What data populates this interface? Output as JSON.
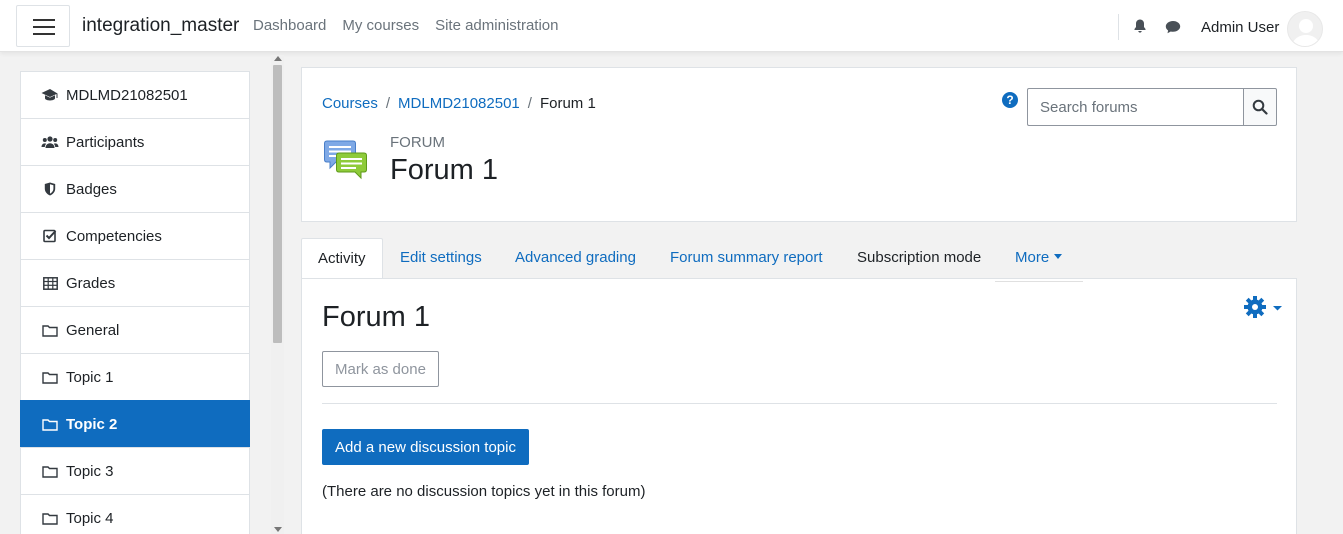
{
  "navbar": {
    "brand": "integration_master",
    "links": [
      "Dashboard",
      "My courses",
      "Site administration"
    ],
    "user_name": "Admin User"
  },
  "drawer": {
    "items": [
      {
        "label": "MDLMD21082501",
        "icon": "graduation-cap-icon"
      },
      {
        "label": "Participants",
        "icon": "users-icon"
      },
      {
        "label": "Badges",
        "icon": "shield-icon"
      },
      {
        "label": "Competencies",
        "icon": "check-square-icon"
      },
      {
        "label": "Grades",
        "icon": "table-icon"
      },
      {
        "label": "General",
        "icon": "folder-icon"
      },
      {
        "label": "Topic 1",
        "icon": "folder-icon"
      },
      {
        "label": "Topic 2",
        "icon": "folder-icon",
        "active": true
      },
      {
        "label": "Topic 3",
        "icon": "folder-icon"
      },
      {
        "label": "Topic 4",
        "icon": "folder-icon"
      }
    ]
  },
  "header": {
    "breadcrumb": [
      "Courses",
      "MDLMD21082501",
      "Forum 1"
    ],
    "breadcrumb_sep": "/",
    "module_type": "FORUM",
    "title": "Forum 1",
    "help": "?",
    "search_placeholder": "Search forums"
  },
  "tabs": [
    {
      "label": "Activity",
      "active": true
    },
    {
      "label": "Edit settings"
    },
    {
      "label": "Advanced grading"
    },
    {
      "label": "Forum summary report"
    },
    {
      "label": "Subscription mode"
    },
    {
      "label": "More"
    }
  ],
  "main": {
    "title": "Forum 1",
    "mark_done_label": "Mark as done",
    "add_topic_label": "Add a new discussion topic",
    "empty_message": "(There are no discussion topics yet in this forum)"
  },
  "colors": {
    "primary": "#0f6cbf",
    "text": "#1d2125",
    "muted": "#6a737b"
  }
}
